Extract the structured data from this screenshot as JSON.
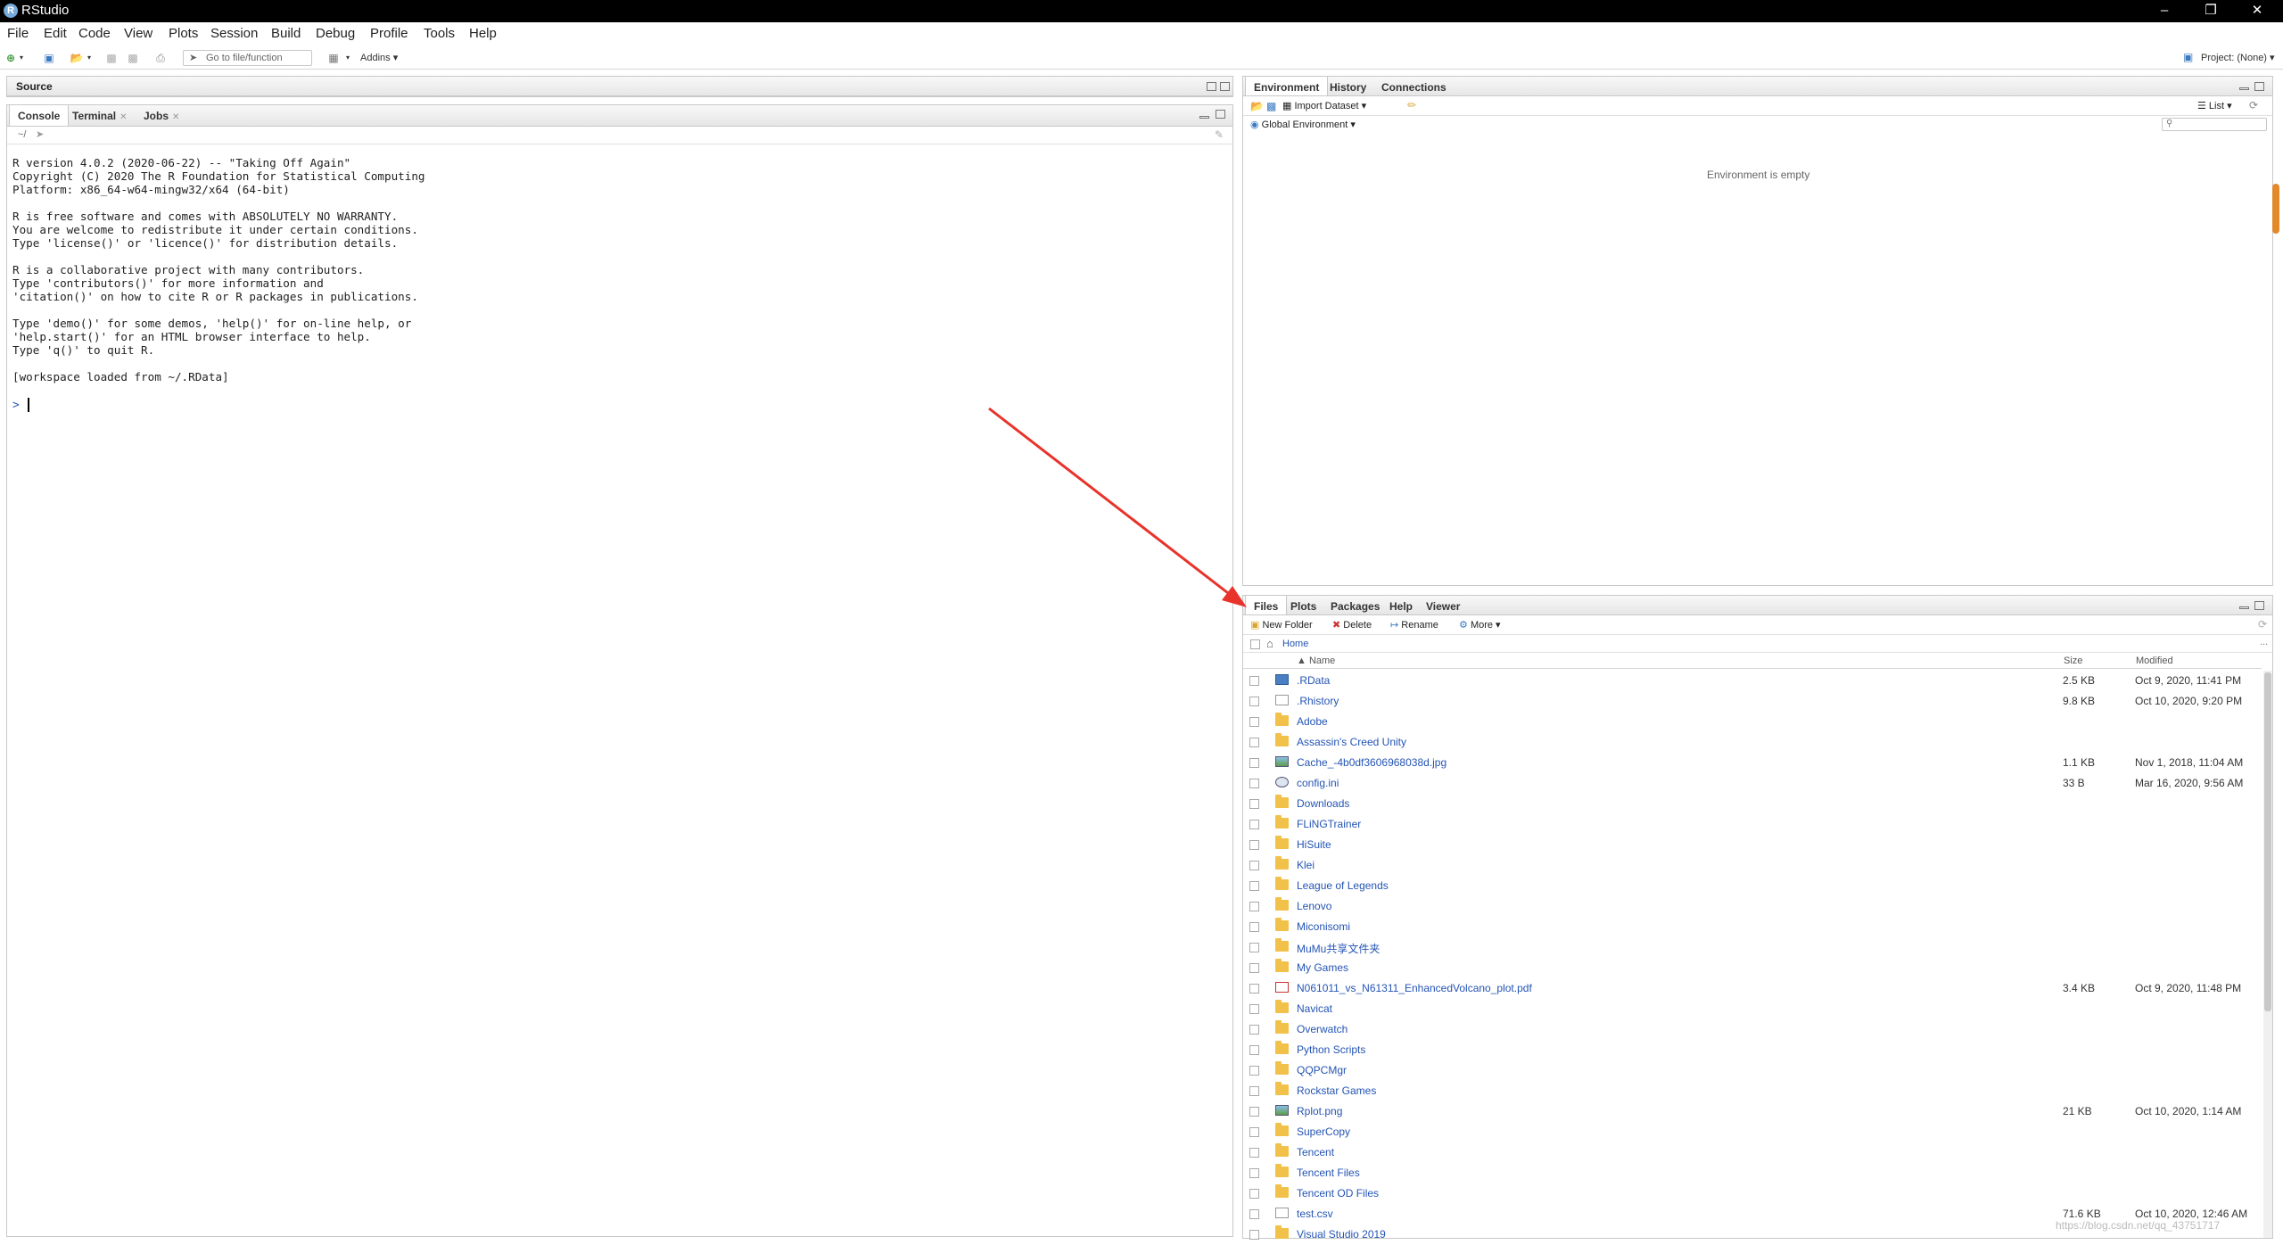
{
  "app": {
    "title": "RStudio"
  },
  "menu": [
    "File",
    "Edit",
    "Code",
    "View",
    "Plots",
    "Session",
    "Build",
    "Debug",
    "Profile",
    "Tools",
    "Help"
  ],
  "toolbar": {
    "goto_placeholder": "Go to file/function",
    "addins_label": "Addins",
    "project_label": "Project: (None)"
  },
  "source_pane": {
    "title": "Source"
  },
  "console_pane": {
    "tabs": [
      "Console",
      "Terminal",
      "Jobs"
    ],
    "path": "~/",
    "output": "R version 4.0.2 (2020-06-22) -- \"Taking Off Again\"\nCopyright (C) 2020 The R Foundation for Statistical Computing\nPlatform: x86_64-w64-mingw32/x64 (64-bit)\n\nR is free software and comes with ABSOLUTELY NO WARRANTY.\nYou are welcome to redistribute it under certain conditions.\nType 'license()' or 'licence()' for distribution details.\n\nR is a collaborative project with many contributors.\nType 'contributors()' for more information and\n'citation()' on how to cite R or R packages in publications.\n\nType 'demo()' for some demos, 'help()' for on-line help, or\n'help.start()' for an HTML browser interface to help.\nType 'q()' to quit R.\n\n[workspace loaded from ~/.RData]",
    "prompt": ">"
  },
  "env_pane": {
    "tabs": [
      "Environment",
      "History",
      "Connections"
    ],
    "import_label": "Import Dataset",
    "list_label": "List",
    "scope_label": "Global Environment",
    "empty_text": "Environment is empty"
  },
  "files_pane": {
    "tabs": [
      "Files",
      "Plots",
      "Packages",
      "Help",
      "Viewer"
    ],
    "actions": {
      "new_folder": "New Folder",
      "delete": "Delete",
      "rename": "Rename",
      "more": "More"
    },
    "breadcrumb": "Home",
    "columns": {
      "name": "Name",
      "size": "Size",
      "modified": "Modified"
    },
    "files": [
      {
        "name": ".RData",
        "size": "2.5 KB",
        "modified": "Oct 9, 2020, 11:41 PM",
        "kind": "rdata"
      },
      {
        "name": ".Rhistory",
        "size": "9.8 KB",
        "modified": "Oct 10, 2020, 9:20 PM",
        "kind": "file"
      },
      {
        "name": "Adobe",
        "size": "",
        "modified": "",
        "kind": "folder"
      },
      {
        "name": "Assassin's Creed Unity",
        "size": "",
        "modified": "",
        "kind": "folder"
      },
      {
        "name": "Cache_-4b0df3606968038d.jpg",
        "size": "1.1 KB",
        "modified": "Nov 1, 2018, 11:04 AM",
        "kind": "img"
      },
      {
        "name": "config.ini",
        "size": "33 B",
        "modified": "Mar 16, 2020, 9:56 AM",
        "kind": "cfg"
      },
      {
        "name": "Downloads",
        "size": "",
        "modified": "",
        "kind": "folder"
      },
      {
        "name": "FLiNGTrainer",
        "size": "",
        "modified": "",
        "kind": "folder"
      },
      {
        "name": "HiSuite",
        "size": "",
        "modified": "",
        "kind": "folder"
      },
      {
        "name": "Klei",
        "size": "",
        "modified": "",
        "kind": "folder"
      },
      {
        "name": "League of Legends",
        "size": "",
        "modified": "",
        "kind": "folder"
      },
      {
        "name": "Lenovo",
        "size": "",
        "modified": "",
        "kind": "folder"
      },
      {
        "name": "Miconisomi",
        "size": "",
        "modified": "",
        "kind": "folder"
      },
      {
        "name": "MuMu共享文件夹",
        "size": "",
        "modified": "",
        "kind": "folder"
      },
      {
        "name": "My Games",
        "size": "",
        "modified": "",
        "kind": "folder"
      },
      {
        "name": "N061011_vs_N61311_EnhancedVolcano_plot.pdf",
        "size": "3.4 KB",
        "modified": "Oct 9, 2020, 11:48 PM",
        "kind": "pdf"
      },
      {
        "name": "Navicat",
        "size": "",
        "modified": "",
        "kind": "folder"
      },
      {
        "name": "Overwatch",
        "size": "",
        "modified": "",
        "kind": "folder"
      },
      {
        "name": "Python Scripts",
        "size": "",
        "modified": "",
        "kind": "folder"
      },
      {
        "name": "QQPCMgr",
        "size": "",
        "modified": "",
        "kind": "folder"
      },
      {
        "name": "Rockstar Games",
        "size": "",
        "modified": "",
        "kind": "folder"
      },
      {
        "name": "Rplot.png",
        "size": "21 KB",
        "modified": "Oct 10, 2020, 1:14 AM",
        "kind": "img"
      },
      {
        "name": "SuperCopy",
        "size": "",
        "modified": "",
        "kind": "folder"
      },
      {
        "name": "Tencent",
        "size": "",
        "modified": "",
        "kind": "folder"
      },
      {
        "name": "Tencent Files",
        "size": "",
        "modified": "",
        "kind": "folder"
      },
      {
        "name": "Tencent OD Files",
        "size": "",
        "modified": "",
        "kind": "folder"
      },
      {
        "name": "test.csv",
        "size": "71.6 KB",
        "modified": "Oct 10, 2020, 12:46 AM",
        "kind": "file"
      },
      {
        "name": "Visual Studio 2019",
        "size": "",
        "modified": "",
        "kind": "folder"
      }
    ]
  },
  "watermark": "https://blog.csdn.net/qq_43751717",
  "colors": {
    "accent": "#2454b4",
    "arrow": "#e8332a",
    "titlebar": "#000000"
  }
}
